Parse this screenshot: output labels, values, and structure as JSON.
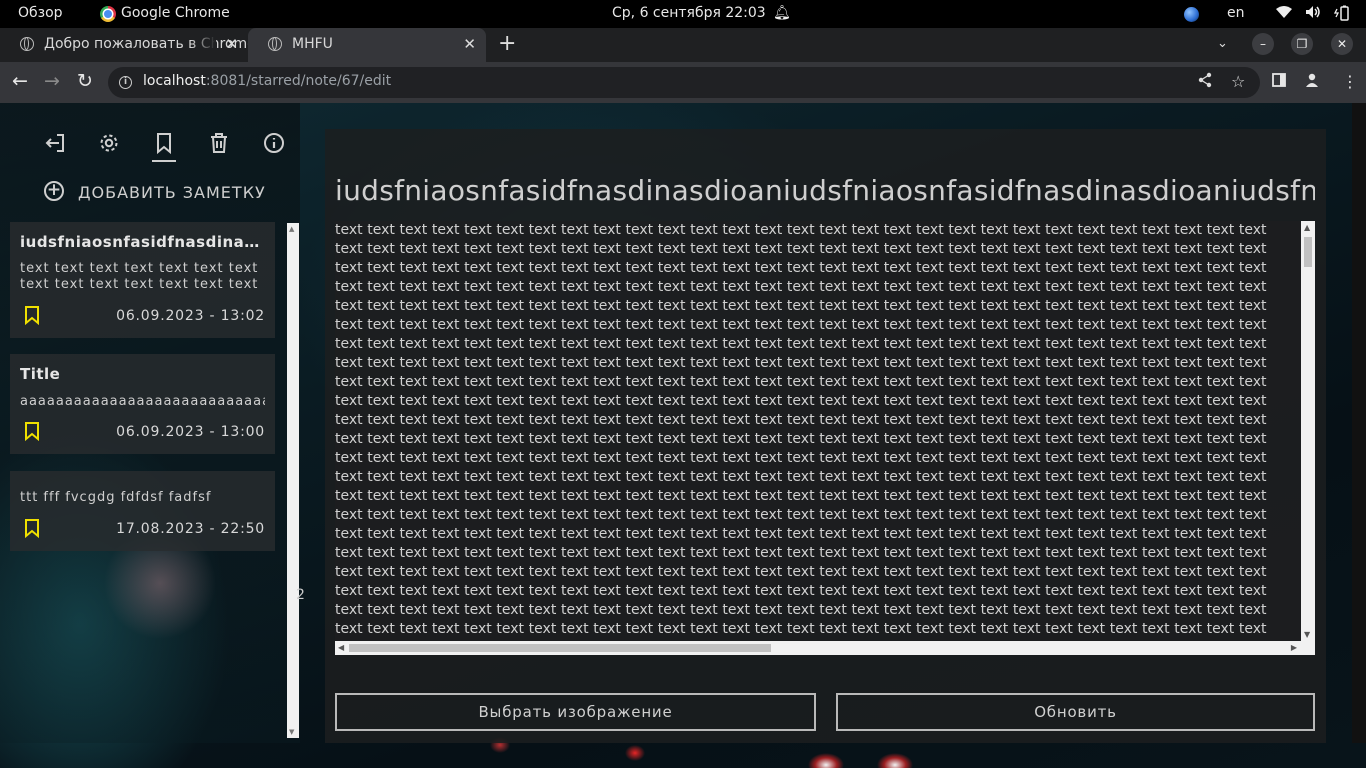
{
  "os": {
    "activities": "Обзор",
    "app_name": "Google Chrome",
    "datetime": "Ср, 6 сентября  22:03",
    "lang": "en"
  },
  "browser": {
    "tabs": [
      {
        "title": "Добро пожаловать в Chrome",
        "active": false
      },
      {
        "title": "MHFU",
        "active": true
      }
    ],
    "url_host": "localhost",
    "url_path": ":8081/starred/note/67/edit"
  },
  "sidebar": {
    "add_note_label": "ДОБАВИТЬ ЗАМЕТКУ",
    "notes": [
      {
        "title": "iudsfniaosnfasidfnasdinasdioaniudsfniaosnfasidfnasdinasdioani",
        "body": "text text text text text text text text text text text text text text text text",
        "date": "06.09.2023 - 13:02"
      },
      {
        "title": "Title",
        "body": "aaaaaaaaaaaaaaaaaaaaaaaaaaaaaaa",
        "date": "06.09.2023 - 13:00"
      },
      {
        "title": "",
        "body": "ttt fff fvcgdg fdfdsf fadfsf",
        "date": "17.08.2023 - 22:50"
      }
    ],
    "side_mark": "2"
  },
  "editor": {
    "title": "iudsfniaosnfasidfnasdinasdioaniudsfniaosnfasidfnasdinasdioaniudsfniaosnfasidfnasdinasdioani",
    "text": "text text text text text text text text text text text text text text text text text text text text text text text text text text text text text text text text text text text text text text text text text text text text text text text text text text text text text text text text text text text text text text text text text text text text text text text text text text text text text text text text text text text text text text text text text text text text text text text text text text text text text text text text text text text text text text text text text text text text text text text text text text text text text text text text text text text text text text text text text text text text text text text text text text text text text text text text text text text text text text text text text text text text text text text text text text text text text text text text text text text text text text text text text text text text text text text text text text text text text text text text text text text text text text text text text text text text text text text text text text text text text text text text text text text text text text text text text text text text text text text text text text text text text text text text text text text text text text text text text text text text text text text text text text text text text text text text text text text text text text text text text text text text text text text text text text text text text text text text text text text text text text text text text text text text text text text text text text text text text text text text text text text text text text text text text text text text text text text text text text text text text text text text text text text text text text text text text text text text text text text text text text text text text text text text text text text text text text text text text text text text text text text text text text text text text text text text text text text text text text text text text text text text text text text text text text text text text text text text text text text text text text text text text text text text text text text text text text text text text text text text text text text text text text text text text text text text text text text text text text text text text text text text text text text text text text text text text text text text text text text text text text text text text text text text text text text text text text text text text text text text text text text text text text text text text text text text text text text text text text text text text text text text text text text text text text text text text text text text text text text text text text text text text text text text text text text text text text text text text text text text text text text text text text text text text text text text text text text text text text text text text text text text text text text text text text text text text text text text text text text text text text text text text text text text text text text text text text text text text text text text text text text text text text text text text text text text text text text text text text text text text text text text text text text text text text text text text text text text text text text text text",
    "choose_image_label": "Выбрать изображение",
    "update_label": "Обновить"
  },
  "colors": {
    "accent_yellow": "#f0e000",
    "text_light": "#d0d0d0"
  }
}
